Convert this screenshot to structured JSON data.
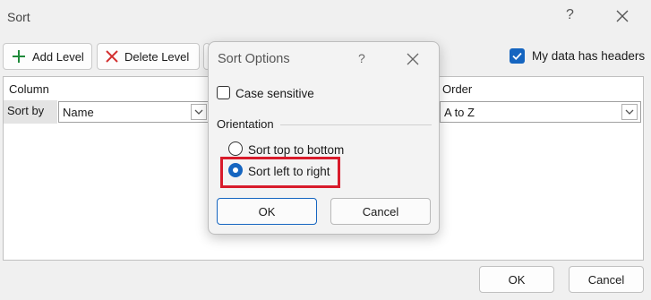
{
  "window": {
    "title": "Sort",
    "help_symbol": "?"
  },
  "toolbar": {
    "add_level": "Add Level",
    "delete_level": "Delete Level",
    "my_data_headers": "My data has headers",
    "my_data_headers_checked": true
  },
  "grid": {
    "column_header": "Column",
    "order_header": "Order",
    "sort_by_label": "Sort by",
    "sort_by_value": "Name",
    "order_value": "A to Z"
  },
  "footer": {
    "ok": "OK",
    "cancel": "Cancel"
  },
  "dialog": {
    "title": "Sort Options",
    "help_symbol": "?",
    "case_sensitive": "Case sensitive",
    "case_sensitive_checked": false,
    "orientation_label": "Orientation",
    "sort_top_to_bottom": "Sort top to bottom",
    "sort_left_to_right": "Sort left to right",
    "selected_orientation": "left_to_right",
    "ok": "OK",
    "cancel": "Cancel"
  },
  "colors": {
    "accent": "#1565c0",
    "highlight": "#d81b2b"
  }
}
